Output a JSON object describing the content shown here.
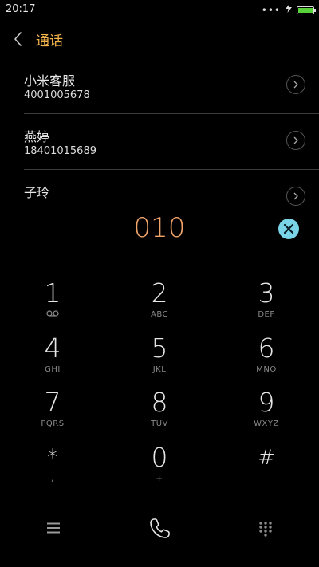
{
  "status_bar": {
    "time": "20:17",
    "indicators": "•••",
    "battery_color": "#59d13b"
  },
  "header": {
    "title": "通话",
    "title_color": "#f4b44b",
    "back_icon": "chevron-left-icon"
  },
  "contacts": [
    {
      "name": "小米客服",
      "number": "4001005678"
    },
    {
      "name": "燕婷",
      "number": "18401015689"
    },
    {
      "name": "子玲",
      "number": ""
    }
  ],
  "dialer": {
    "typed_number": "010",
    "typed_color": "#f0a46a",
    "clear_icon": "clear-icon",
    "clear_color": "#7ad3e6"
  },
  "keypad": {
    "keys": [
      {
        "digit": "1",
        "letters": "voicemail"
      },
      {
        "digit": "2",
        "letters": "ABC"
      },
      {
        "digit": "3",
        "letters": "DEF"
      },
      {
        "digit": "4",
        "letters": "GHI"
      },
      {
        "digit": "5",
        "letters": "JKL"
      },
      {
        "digit": "6",
        "letters": "MNO"
      },
      {
        "digit": "7",
        "letters": "PQRS"
      },
      {
        "digit": "8",
        "letters": "TUV"
      },
      {
        "digit": "9",
        "letters": "WXYZ"
      },
      {
        "digit": "*",
        "letters": ","
      },
      {
        "digit": "0",
        "letters": "+"
      },
      {
        "digit": "#",
        "letters": ""
      }
    ]
  },
  "bottom_bar": {
    "menu_icon": "menu-icon",
    "call_icon": "phone-icon",
    "keypad_icon": "dialpad-grid-icon"
  }
}
